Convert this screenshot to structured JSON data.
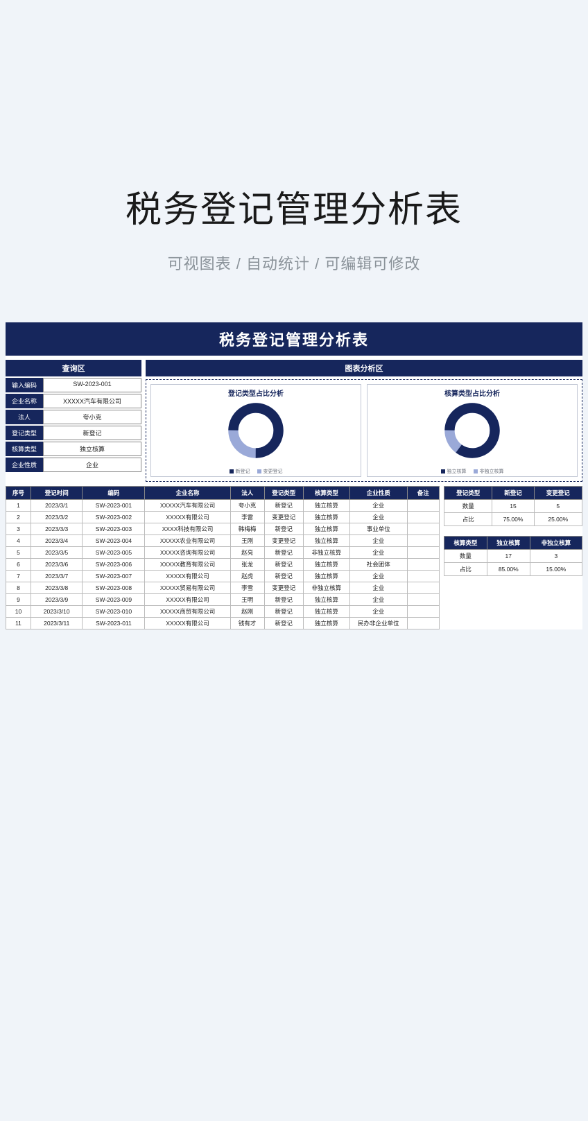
{
  "hero": {
    "title": "税务登记管理分析表",
    "subtitle": "可视图表 / 自动统计 / 可编辑可修改"
  },
  "sheet": {
    "title": "税务登记管理分析表",
    "query_header": "查询区",
    "chart_header": "图表分析区",
    "query": [
      {
        "label": "输入编码",
        "value": "SW-2023-001"
      },
      {
        "label": "企业名称",
        "value": "XXXXX汽车有限公司"
      },
      {
        "label": "法人",
        "value": "夸小克"
      },
      {
        "label": "登记类型",
        "value": "新登记"
      },
      {
        "label": "核算类型",
        "value": "独立核算"
      },
      {
        "label": "企业性质",
        "value": "企业"
      }
    ],
    "columns": [
      "序号",
      "登记时间",
      "编码",
      "企业名称",
      "法人",
      "登记类型",
      "核算类型",
      "企业性质",
      "备注"
    ],
    "rows": [
      {
        "seq": "1",
        "date": "2023/3/1",
        "code": "SW-2023-001",
        "name": "XXXXX汽车有限公司",
        "person": "夸小克",
        "regtype": "新登记",
        "acct": "独立核算",
        "nature": "企业",
        "note": ""
      },
      {
        "seq": "2",
        "date": "2023/3/2",
        "code": "SW-2023-002",
        "name": "XXXXX有限公司",
        "person": "李雷",
        "regtype": "变更登记",
        "acct": "独立核算",
        "nature": "企业",
        "note": ""
      },
      {
        "seq": "3",
        "date": "2023/3/3",
        "code": "SW-2023-003",
        "name": "XXXX科技有限公司",
        "person": "韩梅梅",
        "regtype": "新登记",
        "acct": "独立核算",
        "nature": "事业单位",
        "note": ""
      },
      {
        "seq": "4",
        "date": "2023/3/4",
        "code": "SW-2023-004",
        "name": "XXXXX农业有限公司",
        "person": "王刚",
        "regtype": "变更登记",
        "acct": "独立核算",
        "nature": "企业",
        "note": ""
      },
      {
        "seq": "5",
        "date": "2023/3/5",
        "code": "SW-2023-005",
        "name": "XXXXX咨询有限公司",
        "person": "赵亮",
        "regtype": "新登记",
        "acct": "非独立核算",
        "nature": "企业",
        "note": ""
      },
      {
        "seq": "6",
        "date": "2023/3/6",
        "code": "SW-2023-006",
        "name": "XXXXX教育有限公司",
        "person": "张龙",
        "regtype": "新登记",
        "acct": "独立核算",
        "nature": "社会团体",
        "note": ""
      },
      {
        "seq": "7",
        "date": "2023/3/7",
        "code": "SW-2023-007",
        "name": "XXXXX有限公司",
        "person": "赵虎",
        "regtype": "新登记",
        "acct": "独立核算",
        "nature": "企业",
        "note": ""
      },
      {
        "seq": "8",
        "date": "2023/3/8",
        "code": "SW-2023-008",
        "name": "XXXXX贸易有限公司",
        "person": "李雪",
        "regtype": "变更登记",
        "acct": "非独立核算",
        "nature": "企业",
        "note": ""
      },
      {
        "seq": "9",
        "date": "2023/3/9",
        "code": "SW-2023-009",
        "name": "XXXXX有限公司",
        "person": "王明",
        "regtype": "新登记",
        "acct": "独立核算",
        "nature": "企业",
        "note": ""
      },
      {
        "seq": "10",
        "date": "2023/3/10",
        "code": "SW-2023-010",
        "name": "XXXXX商贸有限公司",
        "person": "赵刚",
        "regtype": "新登记",
        "acct": "独立核算",
        "nature": "企业",
        "note": ""
      },
      {
        "seq": "11",
        "date": "2023/3/11",
        "code": "SW-2023-011",
        "name": "XXXXX有限公司",
        "person": "钱有才",
        "regtype": "新登记",
        "acct": "独立核算",
        "nature": "民办非企业单位",
        "note": ""
      }
    ],
    "side1": {
      "headers": [
        "登记类型",
        "新登记",
        "变更登记"
      ],
      "rows": [
        {
          "label": "数量",
          "a": "15",
          "b": "5"
        },
        {
          "label": "占比",
          "a": "75.00%",
          "b": "25.00%"
        }
      ]
    },
    "side2": {
      "headers": [
        "核算类型",
        "独立核算",
        "非独立核算"
      ],
      "rows": [
        {
          "label": "数量",
          "a": "17",
          "b": "3"
        },
        {
          "label": "占比",
          "a": "85.00%",
          "b": "15.00%"
        }
      ]
    }
  },
  "chart_data": [
    {
      "type": "pie",
      "title": "登记类型占比分析",
      "categories": [
        "新登记",
        "变更登记"
      ],
      "values": [
        75,
        25
      ],
      "legend": [
        "新登记",
        "变更登记"
      ],
      "colors": [
        "#16265c",
        "#9aa9d8"
      ]
    },
    {
      "type": "pie",
      "title": "核算类型占比分析",
      "categories": [
        "独立核算",
        "非独立核算"
      ],
      "values": [
        85,
        15
      ],
      "legend": [
        "独立核算",
        "非独立核算"
      ],
      "colors": [
        "#16265c",
        "#9aa9d8"
      ]
    }
  ]
}
